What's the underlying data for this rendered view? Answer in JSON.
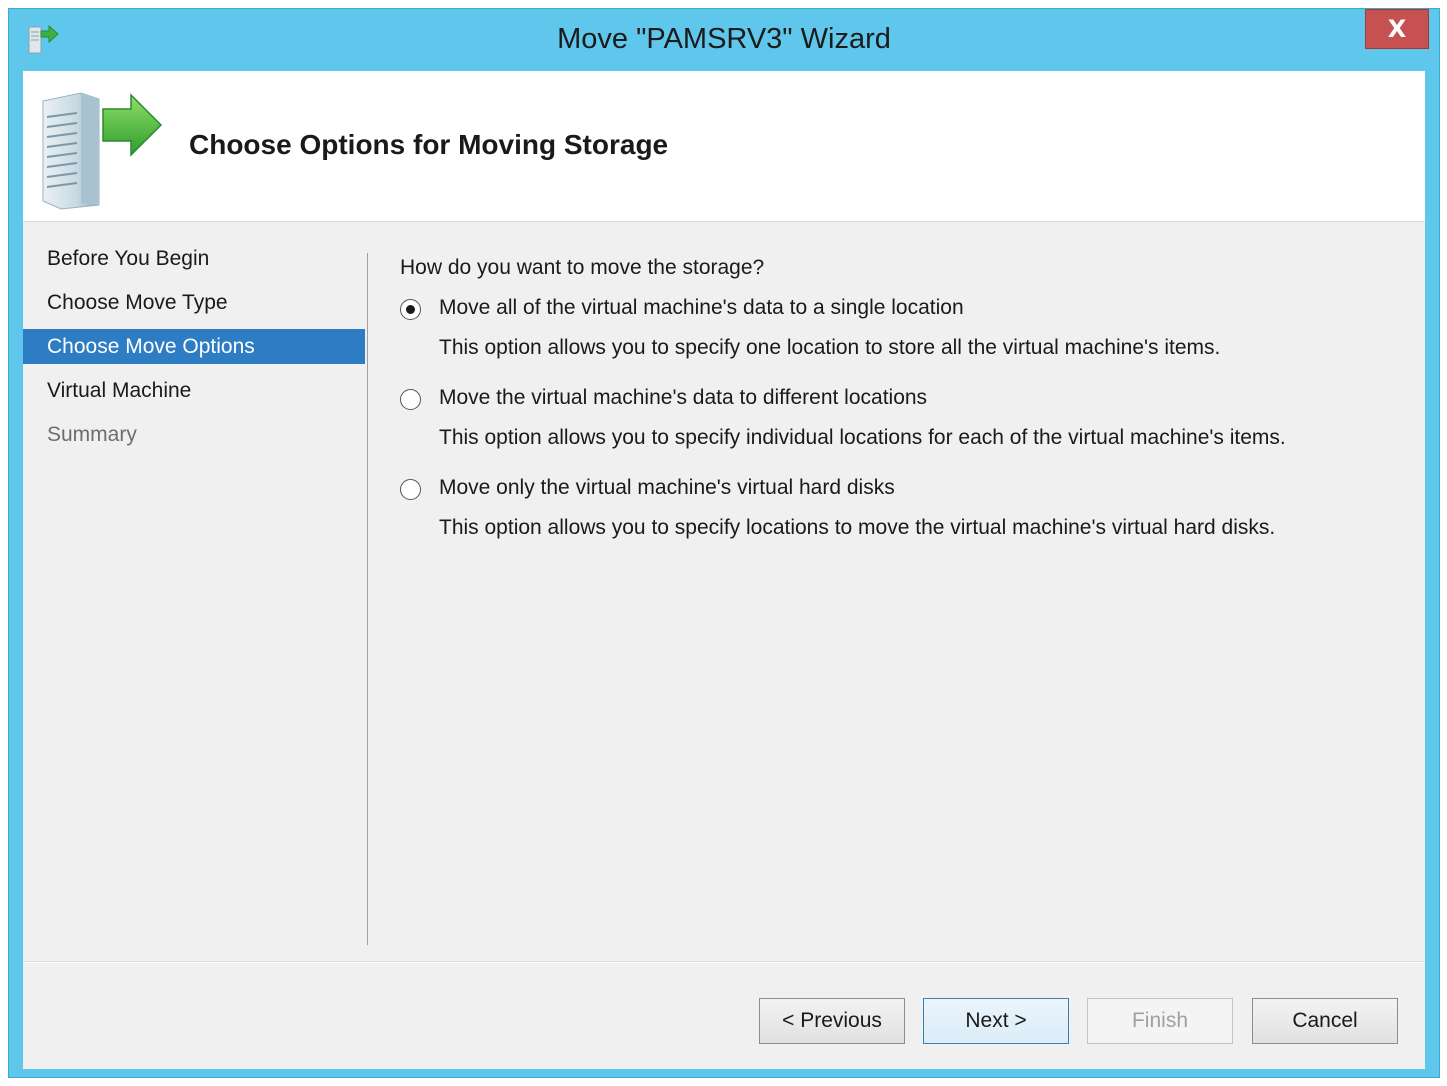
{
  "window": {
    "title": "Move \"PAMSRV3\" Wizard",
    "close_label": "X",
    "accent_color": "#5fc7ec"
  },
  "header": {
    "page_title": "Choose Options for Moving Storage",
    "icon": "server-arrow-icon"
  },
  "steps": [
    {
      "label": "Before You Begin",
      "state": "done"
    },
    {
      "label": "Choose Move Type",
      "state": "done"
    },
    {
      "label": "Choose Move Options",
      "state": "active"
    },
    {
      "label": "Virtual Machine",
      "state": "pending"
    },
    {
      "label": "Summary",
      "state": "disabled"
    }
  ],
  "content": {
    "question": "How do you want to move the storage?",
    "options": [
      {
        "label": "Move all of the virtual machine's data to a single location",
        "description": "This option allows you to specify one location to store all the virtual machine's items.",
        "checked": true
      },
      {
        "label": "Move the virtual machine's data to different locations",
        "description": "This option allows you to specify individual locations for each of the virtual machine's items.",
        "checked": false
      },
      {
        "label": "Move only the virtual machine's virtual hard disks",
        "description": "This option allows you to specify locations to move the virtual machine's virtual hard disks.",
        "checked": false
      }
    ]
  },
  "buttons": {
    "previous": "< Previous",
    "next": "Next >",
    "finish": "Finish",
    "cancel": "Cancel"
  }
}
